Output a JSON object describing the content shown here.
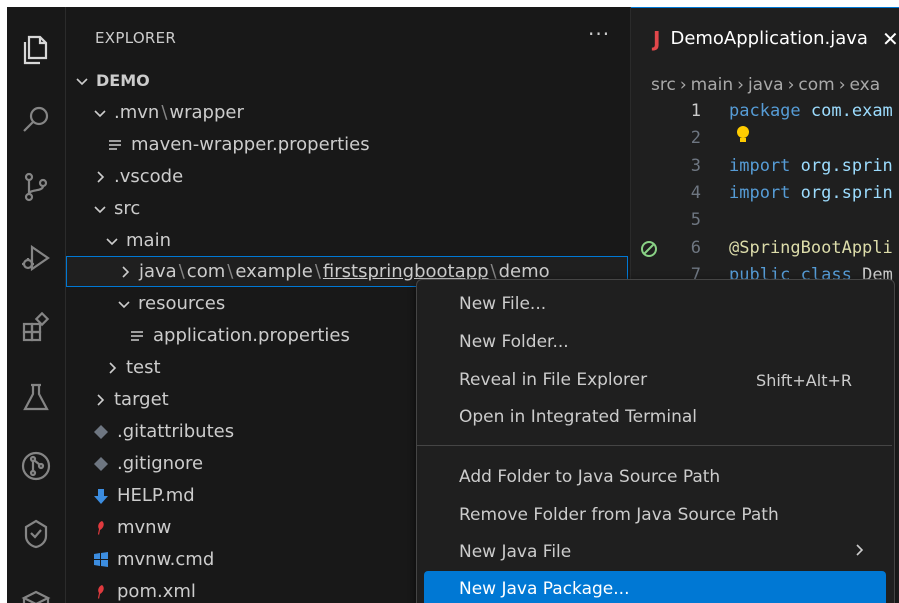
{
  "explorer": {
    "title": "EXPLORER",
    "more_label": "···",
    "project": "DEMO",
    "tree": {
      "mvn": ".mvn",
      "wrapper": "wrapper",
      "maven_props": "maven-wrapper.properties",
      "vscode": ".vscode",
      "src": "src",
      "main": "main",
      "java": "java",
      "com": "com",
      "example": "example",
      "firstspringbootapp": "firstspringbootapp",
      "demo": "demo",
      "resources": "resources",
      "app_props": "application.properties",
      "test": "test",
      "target": "target",
      "gitattributes": ".gitattributes",
      "gitignore": ".gitignore",
      "help": "HELP.md",
      "mvnw": "mvnw",
      "mvnw_cmd": "mvnw.cmd",
      "pom": "pom.xml"
    }
  },
  "editor": {
    "tab_label": "DemoApplication.java",
    "tab_close": "✕",
    "breadcrumbs": [
      "src",
      "main",
      "java",
      "com",
      "exa"
    ],
    "lines": [
      {
        "num": "1",
        "tokens": [
          [
            "kw",
            "package"
          ],
          [
            "txt",
            " "
          ],
          [
            "pkg",
            "com.exam"
          ]
        ]
      },
      {
        "num": "2",
        "tokens": []
      },
      {
        "num": "3",
        "tokens": [
          [
            "kw",
            "import"
          ],
          [
            "txt",
            " "
          ],
          [
            "pkg",
            "org.sprin"
          ]
        ]
      },
      {
        "num": "4",
        "tokens": [
          [
            "kw",
            "import"
          ],
          [
            "txt",
            " "
          ],
          [
            "pkg",
            "org.sprin"
          ]
        ]
      },
      {
        "num": "5",
        "tokens": []
      },
      {
        "num": "6",
        "tokens": [
          [
            "ann",
            "@SpringBootAppli"
          ]
        ]
      },
      {
        "num": "7",
        "tokens": [
          [
            "kw",
            "public"
          ],
          [
            "txt",
            " "
          ],
          [
            "kw",
            "class"
          ],
          [
            "txt",
            " Dem"
          ]
        ]
      }
    ]
  },
  "context_menu": {
    "items": [
      {
        "label": "New File...",
        "shortcut": ""
      },
      {
        "label": "New Folder...",
        "shortcut": ""
      },
      {
        "label": "Reveal in File Explorer",
        "shortcut": "Shift+Alt+R"
      },
      {
        "label": "Open in Integrated Terminal",
        "shortcut": ""
      },
      {
        "label": "Add Folder to Java Source Path",
        "shortcut": ""
      },
      {
        "label": "Remove Folder from Java Source Path",
        "shortcut": ""
      },
      {
        "label": "New Java File",
        "shortcut": ""
      },
      {
        "label": "New Java Package...",
        "shortcut": ""
      }
    ]
  },
  "colors": {
    "accent": "#0078d4",
    "java_icon": "#e2474b",
    "markdown_icon": "#3c8de0",
    "windows_icon": "#3c8de0",
    "maven_icon": "#e03a3e"
  },
  "icons": {
    "activity": [
      "explorer-icon",
      "search-icon",
      "source-control-icon",
      "run-debug-icon",
      "extensions-icon",
      "testing-icon",
      "git-graph-icon",
      "remote-explorer-icon",
      "docker-icon"
    ]
  }
}
